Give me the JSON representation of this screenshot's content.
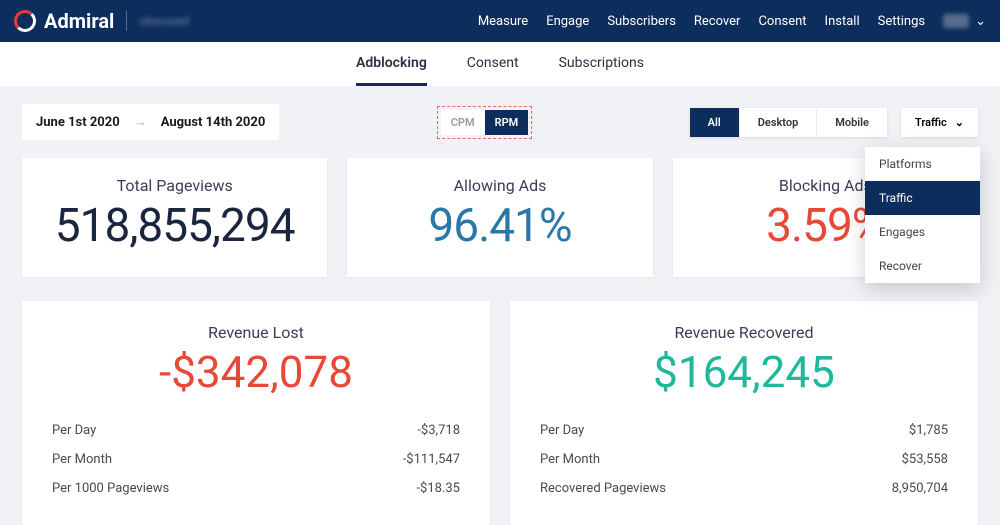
{
  "header": {
    "brand": "Admiral",
    "nav": [
      "Measure",
      "Engage",
      "Subscribers",
      "Recover",
      "Consent",
      "Install",
      "Settings"
    ]
  },
  "subnav": {
    "items": [
      "Adblocking",
      "Consent",
      "Subscriptions"
    ],
    "active": "Adblocking"
  },
  "dateRange": {
    "start": "June 1st 2020",
    "end": "August 14th 2020"
  },
  "rpmToggle": {
    "cpm": "CPM",
    "rpm": "RPM"
  },
  "deviceFilter": [
    "All",
    "Desktop",
    "Mobile"
  ],
  "trafficDropdown": {
    "label": "Traffic",
    "items": [
      "Platforms",
      "Traffic",
      "Engages",
      "Recover"
    ],
    "selected": "Traffic"
  },
  "stats": [
    {
      "label": "Total Pageviews",
      "value": "518,855,294",
      "cls": "v-dark"
    },
    {
      "label": "Allowing Ads",
      "value": "96.41%",
      "cls": "v-blue"
    },
    {
      "label": "Blocking Ads",
      "value": "3.59%",
      "cls": "v-red"
    }
  ],
  "revenueLost": {
    "title": "Revenue Lost",
    "value": "-$342,078",
    "lines": [
      {
        "label": "Per Day",
        "value": "-$3,718"
      },
      {
        "label": "Per Month",
        "value": "-$111,547"
      },
      {
        "label": "Per 1000 Pageviews",
        "value": "-$18.35"
      }
    ]
  },
  "revenueRecovered": {
    "title": "Revenue Recovered",
    "value": "$164,245",
    "lines": [
      {
        "label": "Per Day",
        "value": "$1,785"
      },
      {
        "label": "Per Month",
        "value": "$53,558"
      },
      {
        "label": "Recovered Pageviews",
        "value": "8,950,704"
      }
    ]
  }
}
